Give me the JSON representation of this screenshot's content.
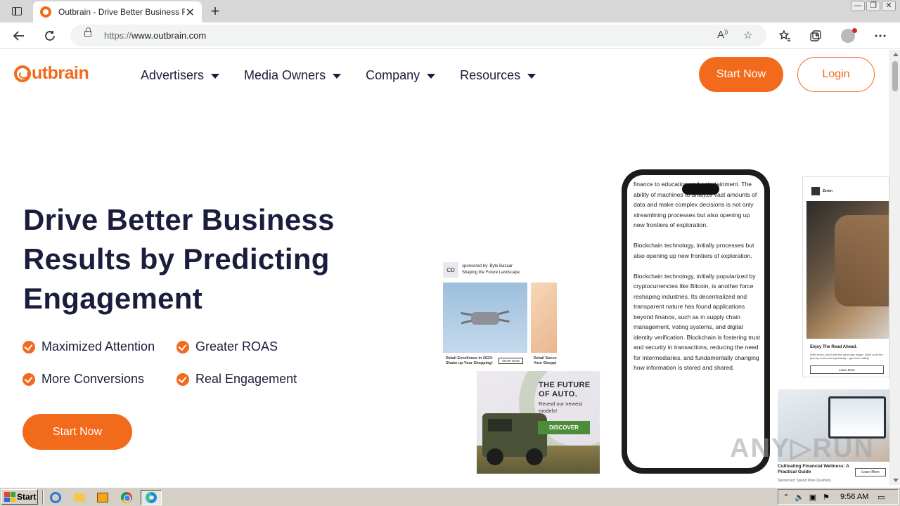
{
  "browser": {
    "tab_title": "Outbrain - Drive Better Business R",
    "tab_close": "✕",
    "new_tab": "+",
    "url_prefix": "https://",
    "url_host": "www.outbrain.com",
    "window_controls": [
      "—",
      "❐",
      "✕"
    ],
    "icons": [
      "back-icon",
      "refresh-icon",
      "lock-icon",
      "read-aloud-icon",
      "add-favorite-icon",
      "favorites-icon",
      "collections-icon",
      "profile-icon",
      "more-icon"
    ]
  },
  "site": {
    "logo_text": "utbrain",
    "nav": [
      {
        "label": "Advertisers"
      },
      {
        "label": "Media Owners"
      },
      {
        "label": "Company"
      },
      {
        "label": "Resources"
      }
    ],
    "header_start": "Start Now",
    "header_login": "Login",
    "headline": "Drive Better Business Results by Predicting Engagement",
    "features": [
      "Maximized Attention",
      "Greater ROAS",
      "More Conversions",
      "Real Engagement"
    ],
    "hero_start": "Start Now",
    "accent_color": "#f26a1b",
    "text_color": "#1b1d3c"
  },
  "collage": {
    "ad1": {
      "logo": "CD",
      "sponsored": "sponsored by: Byte Bazaar",
      "tagline": "Shaping the Future Landscape",
      "caption1": "Retail Excellence in 2023: Shake up Your Shopping!",
      "shop": "SHOP NOW",
      "caption2": "Retail Succe Your Shoppi"
    },
    "ad2": {
      "headline": "THE FUTURE OF AUTO.",
      "sub": "Reveal our newest models!",
      "button": "DISCOVER"
    },
    "phone_text": "finance to education and entertainment. The ability of machines to analyze vast amounts of data and make complex decisions is not only streamlining processes but also opening up new frontiers of exploration.\n\nBlockchain technology, initially processes but also opening up new frontiers of exploration.\n\nBlockchain technology, initially popularized by cryptocurrencies like Bitcoin, is another force reshaping industries. Its decentralized and transparent nature has found applications beyond finance, such as in supply chain management, voting systems, and digital identity verification. Blockchain is fostering trust and security in transactions, reducing the need for intermediaries, and fundamentally changing how information is stored and shared.",
    "ad3": {
      "brand": "Zeron",
      "headline": "Enjoy The Road Ahead.",
      "body": "With Zeron, you'll with the drive was longer. Drive confi the journey and most importantly – get there safely!",
      "button": "Learn More"
    },
    "ad4": {
      "headline": "Cultivating Financial Wellness: A Practical Guide",
      "sponsored": "Sponsored: Spend Wise Quarterly",
      "button": "Learn More"
    },
    "watermark": "ANY▷RUN"
  },
  "taskbar": {
    "start": "Start",
    "clock": "9:56 AM",
    "tray_icons": [
      "up-arrow-icon",
      "volume-icon",
      "network-icon",
      "flag-icon",
      "monitor-icon"
    ]
  }
}
